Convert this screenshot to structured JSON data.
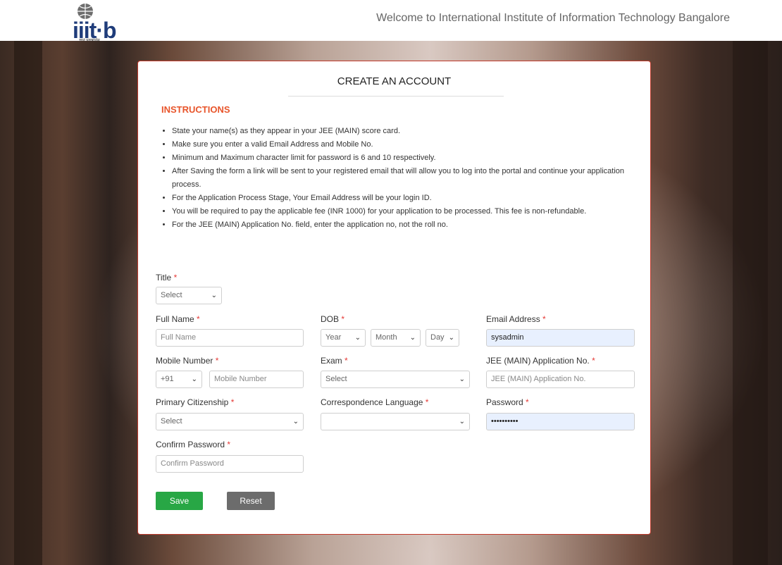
{
  "header": {
    "logo_text": "iiit·b",
    "logo_sub": "ज्ञानं पुरुषार्थम्",
    "welcome": "Welcome to International Institute of Information Technology Bangalore"
  },
  "card": {
    "title": "CREATE AN ACCOUNT",
    "instructions_heading": "INSTRUCTIONS",
    "instructions": [
      "State your name(s) as they appear in your JEE (MAIN) score card.",
      "Make sure you enter a valid Email Address and Mobile No.",
      "Minimum and Maximum character limit for password is 6 and 10 respectively.",
      "After Saving the form a link will be sent to your registered email that will allow you to log into the portal and continue your application process.",
      "For the Application Process Stage, Your Email Address will be your login ID.",
      "You will be required to pay the applicable fee (INR 1000) for your application to be processed. This fee is non-refundable.",
      "For the JEE (MAIN) Application No. field, enter the application no, not the roll no."
    ]
  },
  "form": {
    "required_mark": "*",
    "title": {
      "label": "Title",
      "value": "Select"
    },
    "full_name": {
      "label": "Full Name",
      "placeholder": "Full Name"
    },
    "dob": {
      "label": "DOB",
      "year": "Year",
      "month": "Month",
      "day": "Day"
    },
    "email": {
      "label": "Email Address",
      "value": "sysadmin"
    },
    "mobile": {
      "label": "Mobile Number",
      "code": "+91",
      "placeholder": "Mobile Number"
    },
    "exam": {
      "label": "Exam",
      "value": "Select"
    },
    "jee_app": {
      "label": "JEE (MAIN) Application No.",
      "placeholder": "JEE (MAIN) Application No."
    },
    "citizenship": {
      "label": "Primary Citizenship",
      "value": "Select"
    },
    "language": {
      "label": "Correspondence Language",
      "value": ""
    },
    "password": {
      "label": "Password",
      "value": "••••••••••"
    },
    "confirm_password": {
      "label": "Confirm Password",
      "placeholder": "Confirm Password"
    }
  },
  "buttons": {
    "save": "Save",
    "reset": "Reset"
  },
  "icons": {
    "dropdown": "chevron-down-icon"
  },
  "colors": {
    "accent_orange": "#e8552b",
    "save_green": "#28a745",
    "reset_gray": "#6c6c6c",
    "required_red": "#e53935",
    "card_border": "#c0392b"
  }
}
